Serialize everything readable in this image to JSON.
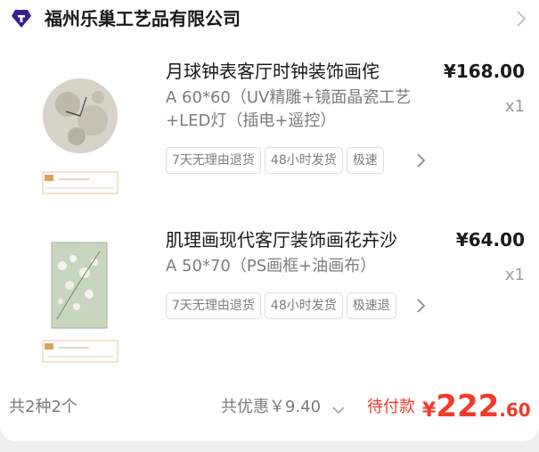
{
  "store": {
    "name": "福州乐巢工艺品有限公司",
    "icon": "store-logo-icon"
  },
  "items": [
    {
      "title": "月球钟表客厅时钟装饰画侘",
      "price": "¥168.00",
      "spec": "A 60*60（UV精雕+镜面晶瓷工艺+LED灯（插电+遥控）",
      "qty": "x1",
      "tags": [
        "7天无理由退货",
        "48小时发货",
        "极速"
      ]
    },
    {
      "title": "肌理画现代客厅装饰画花卉沙",
      "price": "¥64.00",
      "spec": "A 50*70（PS画框+油画布）",
      "qty": "x1",
      "tags": [
        "7天无理由退货",
        "48小时发货",
        "极速退"
      ]
    }
  ],
  "footer": {
    "count": "共2种2个",
    "discount": "共优惠￥9.40",
    "pay_label": "待付款",
    "total_currency": "¥",
    "total_int": "222",
    "total_dec": ".60"
  },
  "colors": {
    "accent": "#f23a2a",
    "logo": "#3a1f8a"
  }
}
